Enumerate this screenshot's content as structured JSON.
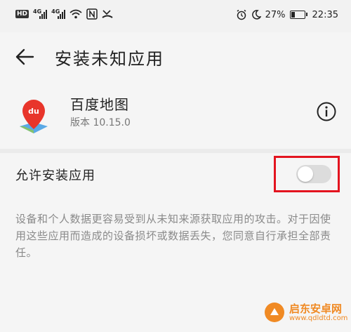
{
  "status_bar": {
    "hd": "HD",
    "network1": "4G",
    "network2": "4G",
    "battery_percent": "27%",
    "time": "22:35",
    "icons": [
      "hd-icon",
      "signal-icon",
      "signal-icon",
      "wifi-icon",
      "nfc-icon",
      "missed-call-icon",
      "alarm-icon",
      "moon-icon",
      "battery-icon"
    ]
  },
  "header": {
    "title": "安装未知应用"
  },
  "app": {
    "name": "百度地图",
    "version": "版本 10.15.0",
    "icon_text": "du",
    "icon_color": "#e8352b"
  },
  "toggle": {
    "label": "允许安装应用",
    "enabled": false
  },
  "warning": {
    "text": "设备和个人数据更容易受到从未知来源获取应用的攻击。对于因使用这些应用而造成的设备损坏或数据丢失，您同意自行承担全部责任。"
  },
  "watermark": {
    "name": "启东安卓网",
    "url": "www.qdldtd.com"
  },
  "colors": {
    "highlight": "#e3141f",
    "watermark": "#f08a24"
  }
}
